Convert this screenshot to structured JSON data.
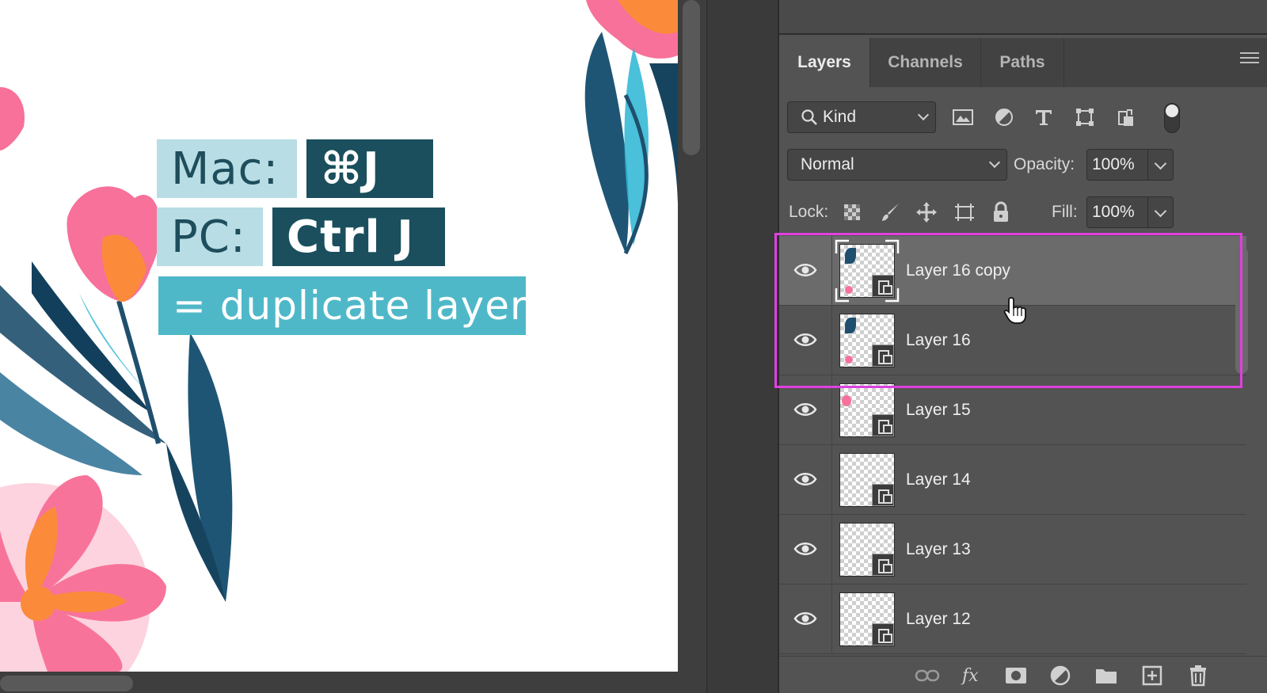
{
  "overlay": {
    "mac_label": "Mac:",
    "mac_keys": "⌘J",
    "pc_label": "PC:",
    "pc_keys": "Ctrl J",
    "action": "= duplicate layer"
  },
  "panel": {
    "tabs": [
      {
        "label": "Layers",
        "active": true
      },
      {
        "label": "Channels",
        "active": false
      },
      {
        "label": "Paths",
        "active": false
      }
    ],
    "filter": {
      "kind_label": "Kind",
      "icons": [
        "image-filter-icon",
        "adjustment-filter-icon",
        "type-filter-icon",
        "shape-filter-icon",
        "smart-object-filter-icon"
      ]
    },
    "blend_mode": "Normal",
    "opacity_label": "Opacity:",
    "opacity_value": "100%",
    "lock_label": "Lock:",
    "lock_icons": [
      "lock-transparent-pixels-icon",
      "lock-image-pixels-icon",
      "lock-position-icon",
      "lock-artboard-icon",
      "lock-all-icon"
    ],
    "fill_label": "Fill:",
    "fill_value": "100%",
    "layers": [
      {
        "name": "Layer 16 copy",
        "visible": true,
        "selected": true,
        "smart_object": true
      },
      {
        "name": "Layer 16",
        "visible": true,
        "selected": false,
        "smart_object": true
      },
      {
        "name": "Layer 15",
        "visible": true,
        "selected": false,
        "smart_object": true
      },
      {
        "name": "Layer 14",
        "visible": true,
        "selected": false,
        "smart_object": true
      },
      {
        "name": "Layer 13",
        "visible": true,
        "selected": false,
        "smart_object": true
      },
      {
        "name": "Layer 12",
        "visible": true,
        "selected": false,
        "smart_object": true
      }
    ],
    "bottom_icons": [
      "link-layers-icon",
      "fx-icon",
      "add-mask-icon",
      "adjustment-layer-icon",
      "new-group-icon",
      "new-layer-icon",
      "delete-layer-icon"
    ]
  },
  "colors": {
    "highlight": "#e040e0",
    "accent_dark": "#1b4f5d",
    "accent_light": "#b8dde4",
    "accent_mid": "#4fb8c8"
  }
}
